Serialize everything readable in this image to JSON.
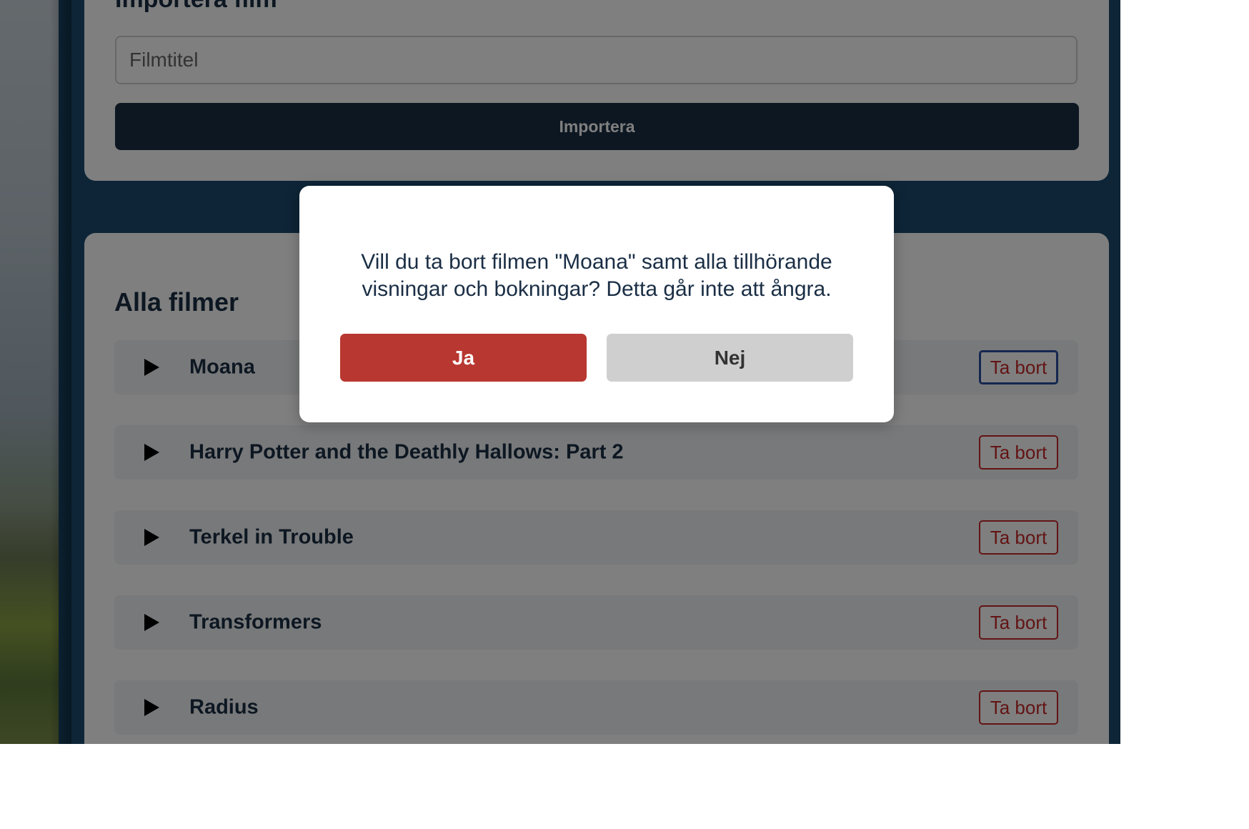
{
  "import": {
    "title": "Importera film",
    "input_placeholder": "Filmtitel",
    "button_label": "Importera"
  },
  "films": {
    "title": "Alla filmer",
    "delete_label": "Ta bort",
    "items": [
      {
        "title": "Moana"
      },
      {
        "title": "Harry Potter and the Deathly Hallows: Part 2"
      },
      {
        "title": "Terkel in Trouble"
      },
      {
        "title": "Transformers"
      },
      {
        "title": "Radius"
      }
    ]
  },
  "modal": {
    "message": "Vill du ta bort filmen \"Moana\" samt alla tillhörande visningar och bokningar? Detta går inte att ångra.",
    "yes_label": "Ja",
    "no_label": "Nej"
  },
  "colors": {
    "primary": "#1a2e45",
    "danger": "#c62828",
    "confirm": "#b83730",
    "cancel": "#cfcfcf",
    "page_background": "#1a4a6e"
  }
}
